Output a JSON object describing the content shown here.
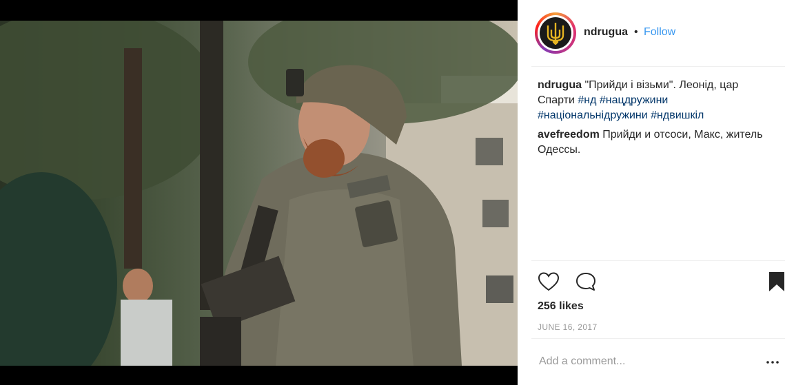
{
  "post": {
    "username": "ndrugua",
    "follow_label": "Follow",
    "separator": "•",
    "comments": [
      {
        "author": "ndrugua",
        "text": "\"Прийди і візьми\". Леонід, цар Спарти ",
        "tags": [
          "#нд",
          "#нацдружини",
          "#національнідружини",
          "#ндвишкіл"
        ]
      },
      {
        "author": "avefreedom",
        "text": "Прийди и отсоси, Макс, житель Одессы.",
        "tags": []
      }
    ],
    "likes": "256 likes",
    "date": "JUNE 16, 2017",
    "add_comment_placeholder": "Add a comment...",
    "more_icon": "ellipsis-icon"
  },
  "colors": {
    "link_blue": "#3897f0",
    "hashtag": "#003569",
    "muted": "#999999",
    "text": "#262626"
  }
}
